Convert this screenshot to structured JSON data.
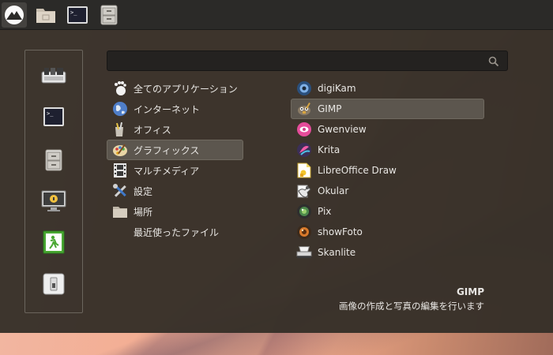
{
  "panel": {
    "launcher_icon": "distro-logo-icon",
    "items": [
      {
        "name": "files-folder-icon"
      },
      {
        "name": "terminal-icon"
      },
      {
        "name": "file-cabinet-icon"
      }
    ]
  },
  "favorites": [
    {
      "name": "software-manager-icon"
    },
    {
      "name": "terminal-icon"
    },
    {
      "name": "file-cabinet-icon"
    },
    {
      "name": "lock-screen-icon"
    },
    {
      "name": "logout-icon"
    },
    {
      "name": "shutdown-icon"
    }
  ],
  "search": {
    "value": "",
    "placeholder": ""
  },
  "categories": [
    {
      "label": "全てのアプリケーション",
      "icon": "gnome-foot-icon",
      "selected": false
    },
    {
      "label": "インターネット",
      "icon": "globe-icon",
      "selected": false
    },
    {
      "label": "オフィス",
      "icon": "office-icon",
      "selected": false
    },
    {
      "label": "グラフィックス",
      "icon": "palette-icon",
      "selected": true
    },
    {
      "label": "マルチメディア",
      "icon": "film-strip-icon",
      "selected": false
    },
    {
      "label": "設定",
      "icon": "tools-icon",
      "selected": false
    },
    {
      "label": "場所",
      "icon": "folder-icon",
      "selected": false
    },
    {
      "label": "最近使ったファイル",
      "icon": "",
      "selected": false
    }
  ],
  "apps": [
    {
      "label": "digiKam",
      "icon": "digikam-icon",
      "selected": false
    },
    {
      "label": "GIMP",
      "icon": "gimp-icon",
      "selected": true
    },
    {
      "label": "Gwenview",
      "icon": "gwenview-icon",
      "selected": false
    },
    {
      "label": "Krita",
      "icon": "krita-icon",
      "selected": false
    },
    {
      "label": "LibreOffice Draw",
      "icon": "libreoffice-draw-icon",
      "selected": false
    },
    {
      "label": "Okular",
      "icon": "okular-icon",
      "selected": false
    },
    {
      "label": "Pix",
      "icon": "pix-icon",
      "selected": false
    },
    {
      "label": "showFoto",
      "icon": "showfoto-icon",
      "selected": false
    },
    {
      "label": "Skanlite",
      "icon": "scanner-icon",
      "selected": false
    }
  ],
  "description": {
    "title": "GIMP",
    "text": "画像の作成と写真の編集を行います"
  }
}
